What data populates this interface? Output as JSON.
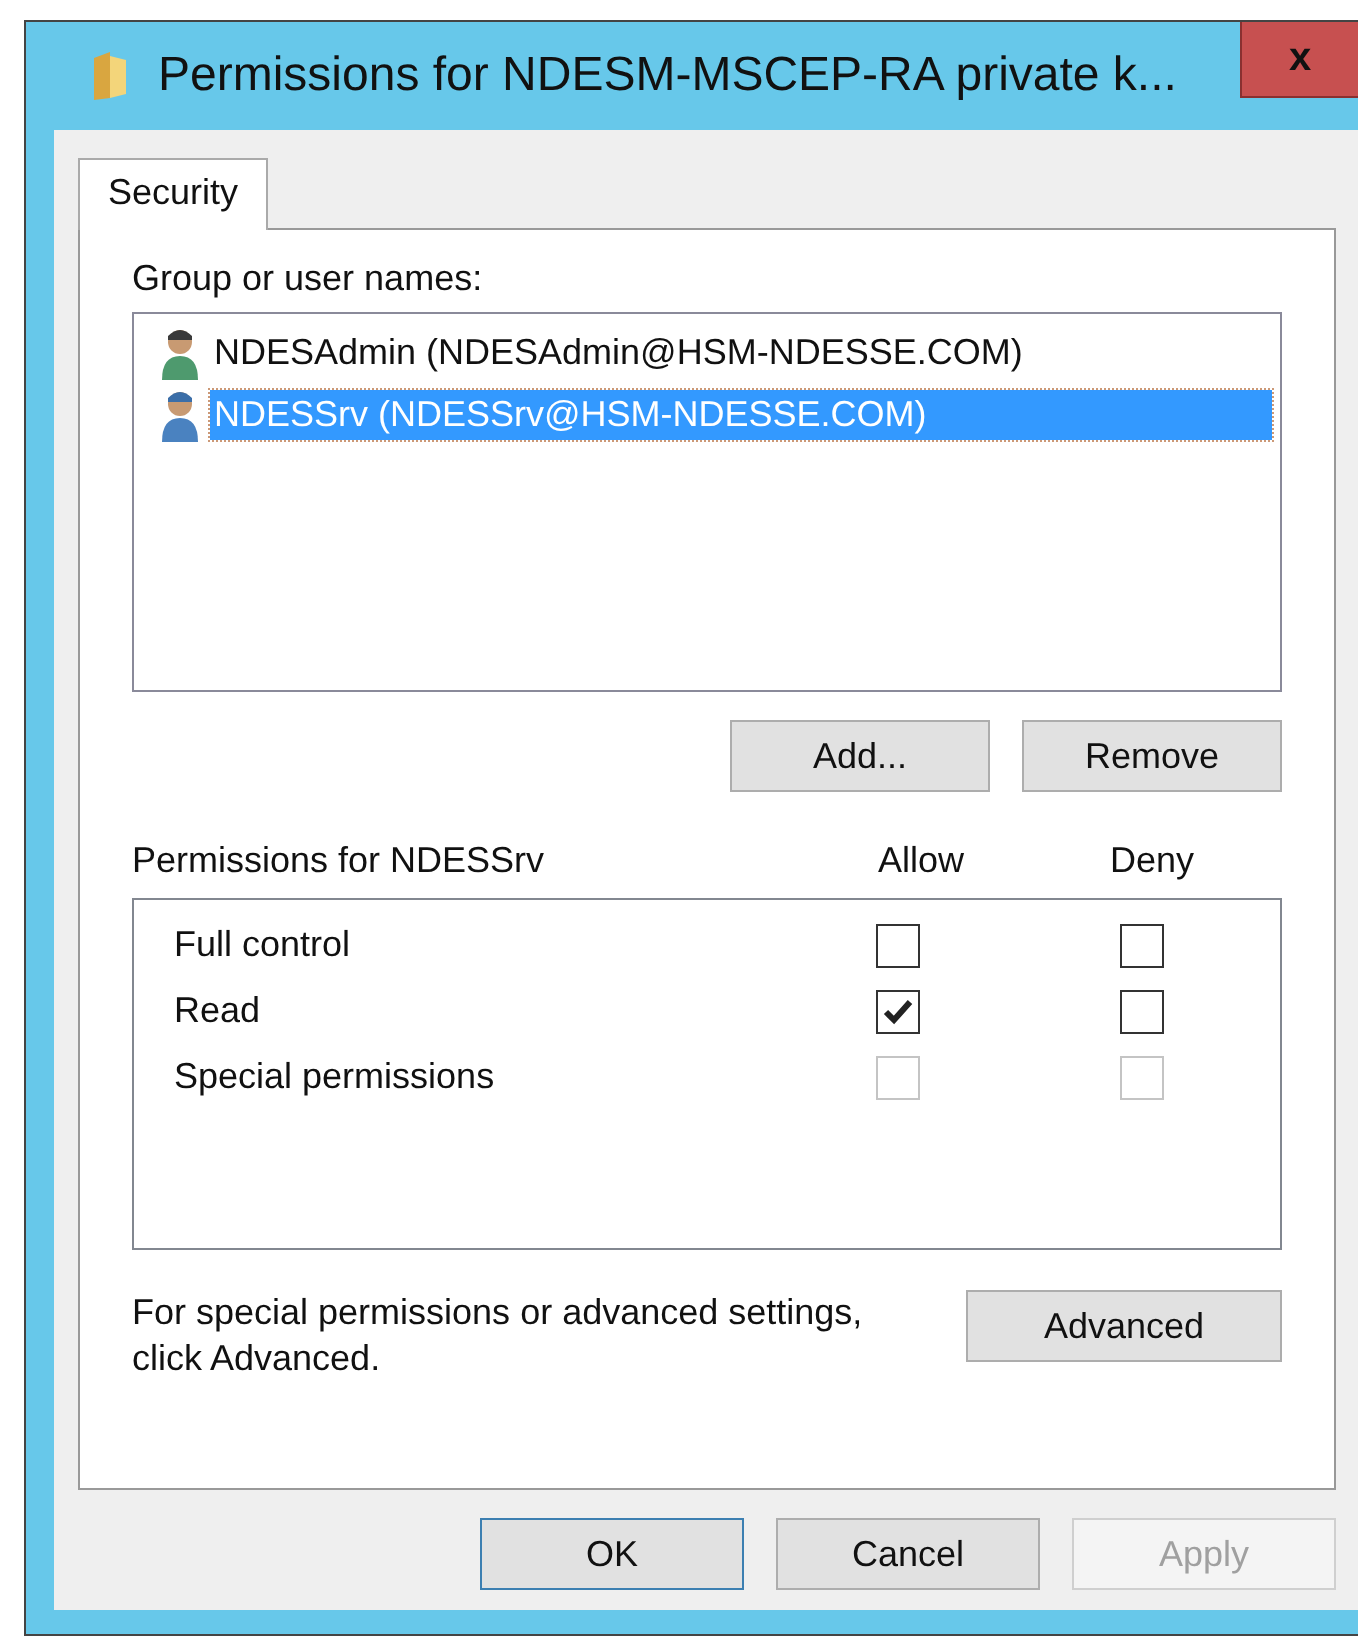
{
  "window": {
    "title": "Permissions for NDESM-MSCEP-RA private k...",
    "close": "x"
  },
  "tabs": [
    {
      "label": "Security",
      "selected": true
    }
  ],
  "users": {
    "label": "Group or user names:",
    "items": [
      {
        "name": "NDESAdmin (NDESAdmin@HSM-NDESSE.COM)",
        "kind": "admin",
        "selected": false
      },
      {
        "name": "NDESSrv (NDESSrv@HSM-NDESSE.COM)",
        "kind": "service",
        "selected": true
      }
    ],
    "buttons": [
      "Add...",
      "Remove"
    ]
  },
  "permissions": {
    "label": "Permissions for NDESSrv",
    "columns": [
      "Allow",
      "Deny"
    ],
    "rows": [
      {
        "name": "Full control",
        "allow": false,
        "deny": false,
        "disabled": false
      },
      {
        "name": "Read",
        "allow": true,
        "deny": false,
        "disabled": false
      },
      {
        "name": "Special permissions",
        "allow": false,
        "deny": false,
        "disabled": true
      }
    ]
  },
  "advanced": {
    "note": "For special permissions or advanced settings, click Advanced.",
    "button": "Advanced"
  },
  "buttons": [
    {
      "label": "OK",
      "default": true,
      "disabled": false
    },
    {
      "label": "Cancel",
      "default": false,
      "disabled": false
    },
    {
      "label": "Apply",
      "default": false,
      "disabled": true
    }
  ]
}
